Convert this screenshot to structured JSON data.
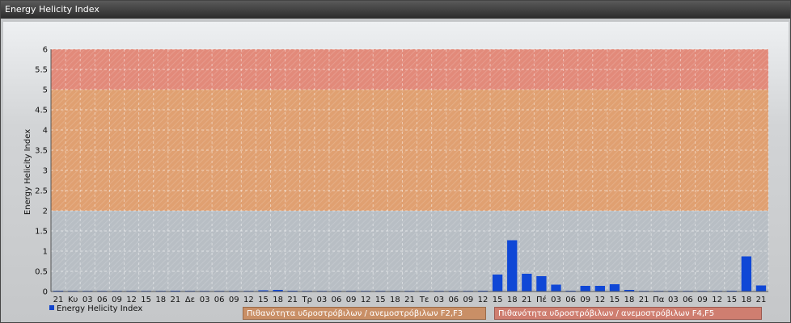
{
  "window": {
    "title": "Energy Helicity Index"
  },
  "colors": {
    "bar": "#0f47d6",
    "band_low": "#b8bec4",
    "band_mid": "#e0a071",
    "band_high": "#e28a7a",
    "grid": "#ffffff"
  },
  "legend": {
    "series_label": "Energy Helicity Index",
    "band_f2f3": "Πιθανότητα υδροστρόβιλων / ανεμοστρόβιλων F2,F3",
    "band_f4f5": "Πιθανότητα υδροστρόβιλων / ανεμοστρόβιλων F4,F5"
  },
  "chart_data": {
    "type": "bar",
    "title": "Energy Helicity Index",
    "ylabel": "Energy Helicity Index",
    "xlabel": "",
    "ylim": [
      0,
      6
    ],
    "yticks": [
      "0",
      "0.5",
      "1",
      "1.5",
      "2",
      "2.5",
      "3",
      "3.5",
      "4",
      "4.5",
      "5",
      "5.5",
      "6"
    ],
    "bands": [
      {
        "from": 2,
        "to": 5,
        "color": "#e0a071"
      },
      {
        "from": 5,
        "to": 6,
        "color": "#e28a7a"
      }
    ],
    "categories": [
      "21",
      "Κυ",
      "03",
      "06",
      "09",
      "12",
      "15",
      "18",
      "21",
      "Δε",
      "03",
      "06",
      "09",
      "12",
      "15",
      "18",
      "21",
      "Τρ",
      "03",
      "06",
      "09",
      "12",
      "15",
      "18",
      "21",
      "Τε",
      "03",
      "06",
      "09",
      "12",
      "15",
      "18",
      "21",
      "Πέ",
      "03",
      "06",
      "09",
      "12",
      "15",
      "18",
      "21",
      "Πα",
      "03",
      "06",
      "09",
      "12",
      "15",
      "18",
      "21"
    ],
    "series": [
      {
        "values": [
          0.02,
          0.01,
          0.01,
          0.01,
          0.01,
          0.01,
          0.01,
          0.01,
          0.02,
          0.01,
          0.01,
          0.01,
          0.01,
          0.01,
          0.03,
          0.04,
          0.02,
          0.01,
          0.01,
          0.01,
          0.01,
          0.01,
          0.01,
          0.01,
          0.01,
          0.01,
          0.01,
          0.01,
          0.01,
          0.02,
          0.42,
          1.27,
          0.44,
          0.38,
          0.17,
          0.02,
          0.14,
          0.14,
          0.18,
          0.04,
          0.01,
          0.01,
          0.01,
          0.01,
          0.01,
          0.01,
          0.02,
          0.87,
          0.15
        ]
      }
    ],
    "grid": true,
    "legend_position": "bottom"
  }
}
